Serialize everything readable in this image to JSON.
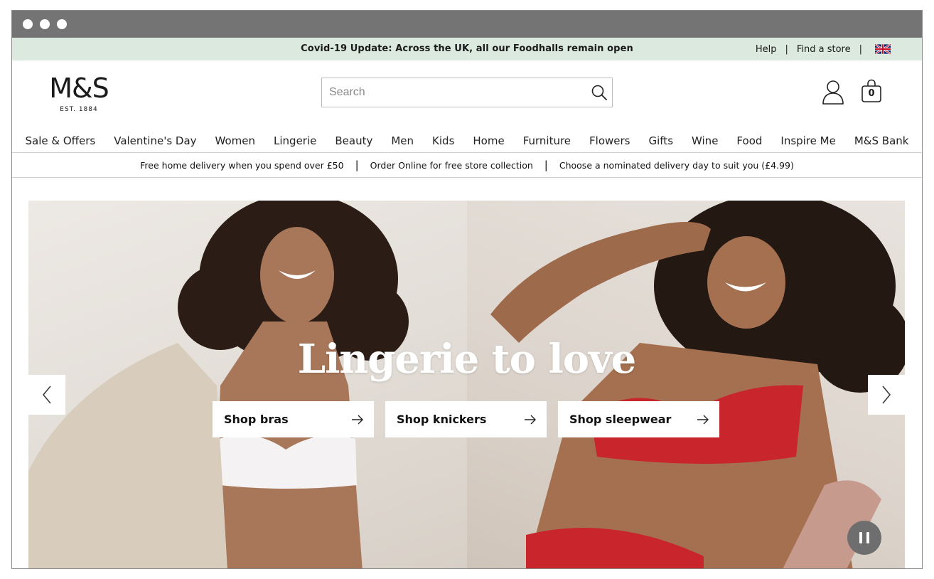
{
  "browser": {
    "window_dots": 3
  },
  "topbar": {
    "notice": "Covid-19 Update: Across the UK, all our Foodhalls remain open",
    "help_label": "Help",
    "separator": "|",
    "find_store_label": "Find a store",
    "flag_icon": "uk-flag-icon"
  },
  "header": {
    "logo_text": "M&S",
    "logo_est": "EST. 1884",
    "search_placeholder": "Search",
    "bag_count": "0"
  },
  "nav": {
    "items": [
      "Sale & Offers",
      "Valentine's Day",
      "Women",
      "Lingerie",
      "Beauty",
      "Men",
      "Kids",
      "Home",
      "Furniture",
      "Flowers",
      "Gifts",
      "Wine",
      "Food",
      "Inspire Me",
      "M&S Bank"
    ]
  },
  "delivery": {
    "items": [
      "Free home delivery when you spend over £50",
      "Order Online for free store collection",
      "Choose a nominated delivery day to suit you (£4.99)"
    ],
    "separator": "|"
  },
  "hero": {
    "headline": "Lingerie to love",
    "ctas": [
      "Shop bras",
      "Shop knickers",
      "Shop sleepwear"
    ]
  },
  "colors": {
    "topbar_bg": "#dbe9df",
    "chrome_bg": "#747474",
    "hero_text": "#ffffff",
    "pause_bg": "#6e6e6e"
  }
}
